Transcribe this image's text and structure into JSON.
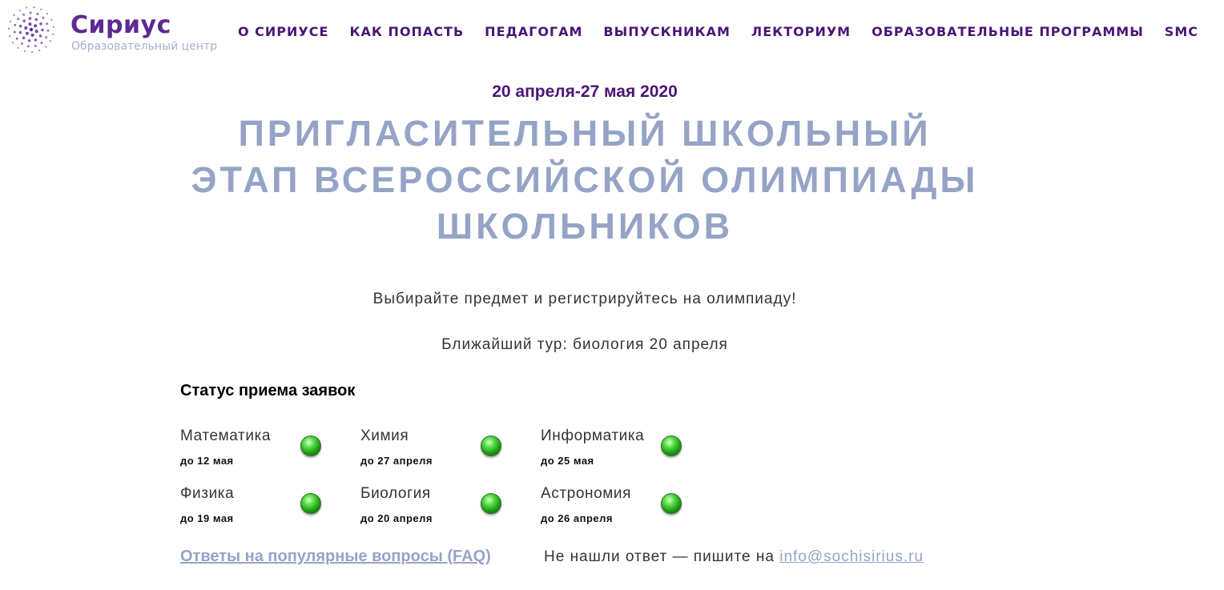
{
  "header": {
    "logo": {
      "title": "Сириус",
      "subtitle": "Образовательный центр",
      "brand_color": "#5c2a91"
    },
    "nav": [
      {
        "label": "О СИРИУСЕ"
      },
      {
        "label": "КАК ПОПАСТЬ"
      },
      {
        "label": "ПЕДАГОГАМ"
      },
      {
        "label": "ВЫПУСКНИКАМ"
      },
      {
        "label": "ЛЕКТОРИУМ"
      },
      {
        "label": "ОБРАЗОВАТЕЛЬНЫЕ ПРОГРАММЫ"
      },
      {
        "label": "SMC"
      }
    ]
  },
  "hero": {
    "date": "20 апреля-27 мая 2020",
    "title_lines": [
      "ПРИГЛАСИТЕЛЬНЫЙ ШКОЛЬНЫЙ",
      "ЭТАП ВСЕРОССИЙСКОЙ ОЛИМПИАДЫ",
      "ШКОЛЬНИКОВ"
    ],
    "subtitle": "Выбирайте предмет и регистрируйтесь на олимпиаду!",
    "nearest": "Ближайший тур: биология 20 апреля"
  },
  "status": {
    "title": "Статус приема заявок",
    "indicator_color": "#3fc12f",
    "subjects": [
      {
        "name": "Математика",
        "deadline": "до 12 мая",
        "status": "open"
      },
      {
        "name": "Химия",
        "deadline": "до 27 апреля",
        "status": "open"
      },
      {
        "name": "Информатика",
        "deadline": "до 25 мая",
        "status": "open"
      },
      {
        "name": "Физика",
        "deadline": "до 19 мая",
        "status": "open"
      },
      {
        "name": "Биология",
        "deadline": "до 20 апреля",
        "status": "open"
      },
      {
        "name": "Астрономия",
        "deadline": "до 26 апреля",
        "status": "open"
      }
    ]
  },
  "footer": {
    "faq_link": "Ответы на популярные вопросы (FAQ)",
    "contact_text": "Не нашли ответ — пишите на",
    "email": "info@sochisirius.ru"
  },
  "icons": {
    "logo_mark": "dot-sphere-icon",
    "status": "green-light-icon"
  }
}
